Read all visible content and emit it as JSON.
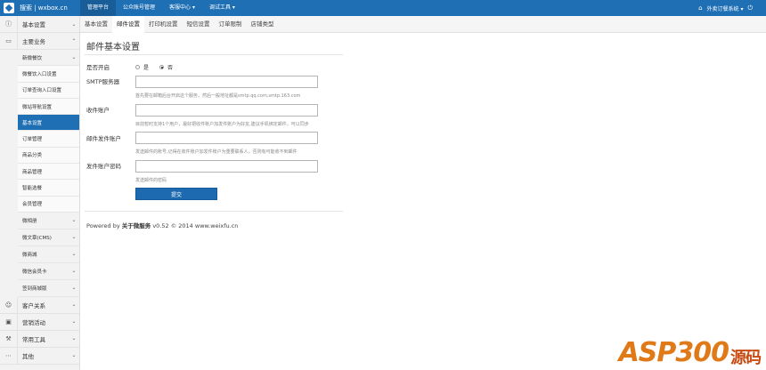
{
  "brand": {
    "text": "搜索 | wxbox.cn"
  },
  "topnav": [
    "管理平台",
    "公众账号管理",
    "客服中心 ▾",
    "调试工具 ▾"
  ],
  "topright": {
    "home_icon": "home-icon",
    "user": "外卖订餐系统 ▾",
    "signout_icon": "signout-icon"
  },
  "sidebar": {
    "sections": [
      {
        "label": "基本设置",
        "icon": "info-icon"
      },
      {
        "label": "主要业务",
        "icon": "folder-icon"
      }
    ],
    "group1": {
      "label": "新微餐饮"
    },
    "subitems": [
      "微餐饮入口设置",
      "订单查询入口设置",
      "微站导航设置",
      "基本设置",
      "订单管理",
      "商品分类",
      "商品管理",
      "智能选餐",
      "会员管理"
    ],
    "groups": [
      "微相册",
      "微文章(CMS)",
      "微商城",
      "微信会员卡",
      "签到商城版"
    ],
    "bottom_sections": [
      {
        "label": "客户关系",
        "icon": "user-icon"
      },
      {
        "label": "营销活动",
        "icon": "gift-icon"
      },
      {
        "label": "常用工具",
        "icon": "wrench-icon"
      },
      {
        "label": "其他",
        "icon": "more-icon"
      }
    ]
  },
  "subtabs": [
    "基本设置",
    "邮件设置",
    "打印机设置",
    "短信设置",
    "订单限制",
    "店铺类型"
  ],
  "page": {
    "title": "邮件基本设置",
    "enable_label": "是否开启",
    "radio_yes": "是",
    "radio_no": "否",
    "smtp_label": "SMTP服务器",
    "smtp_help": "首先要在邮箱后台开启这个服务，然后一般地址都是smtp.qq.com,smtp.163.com",
    "receiver_label": "收件账户",
    "receiver_help": "目前暂时支持1个用户，最好把收件账户加发件账户为好友,建议手机绑定邮件，可以同步",
    "sender_label": "邮件发件账户",
    "sender_help": "发送邮件的账号,记得在收件账户加发件账户为重要联系人，否则有可能收不到邮件",
    "password_label": "发件账户密码",
    "password_help": "发送邮件的密码",
    "submit": "提交"
  },
  "footer": {
    "prefix": "Powered by ",
    "link": "关于微服务",
    "suffix": " v0.52 © 2014 www.weixfu.cn"
  },
  "watermark": {
    "text": "ASP300",
    "cn": "源码"
  }
}
